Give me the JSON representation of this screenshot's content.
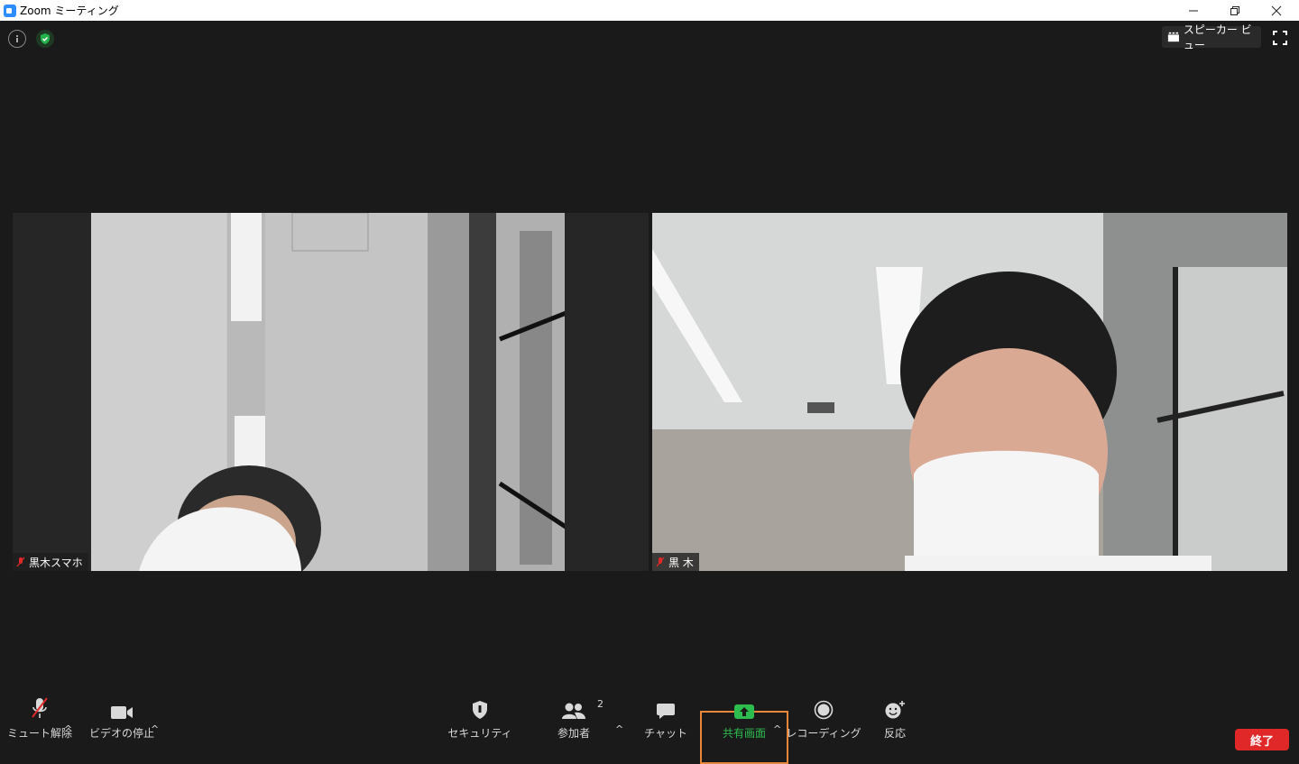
{
  "window": {
    "title": "Zoom ミーティング"
  },
  "top": {
    "speaker_view_label": "スピーカー ビュー"
  },
  "participants": [
    {
      "name": "黒木スマホ",
      "muted": true
    },
    {
      "name": "黒 木",
      "muted": true
    }
  ],
  "toolbar": {
    "mute_label": "ミュート解除",
    "video_label": "ビデオの停止",
    "security_label": "セキュリティ",
    "participants_label": "参加者",
    "participants_count": "2",
    "chat_label": "チャット",
    "share_label": "共有画面",
    "record_label": "レコーディング",
    "reaction_label": "反応",
    "end_label": "終了"
  },
  "colors": {
    "share_green": "#2dbd4e",
    "end_red": "#e02828",
    "highlight_orange": "#e8863a",
    "shield_green": "#23b24b"
  }
}
